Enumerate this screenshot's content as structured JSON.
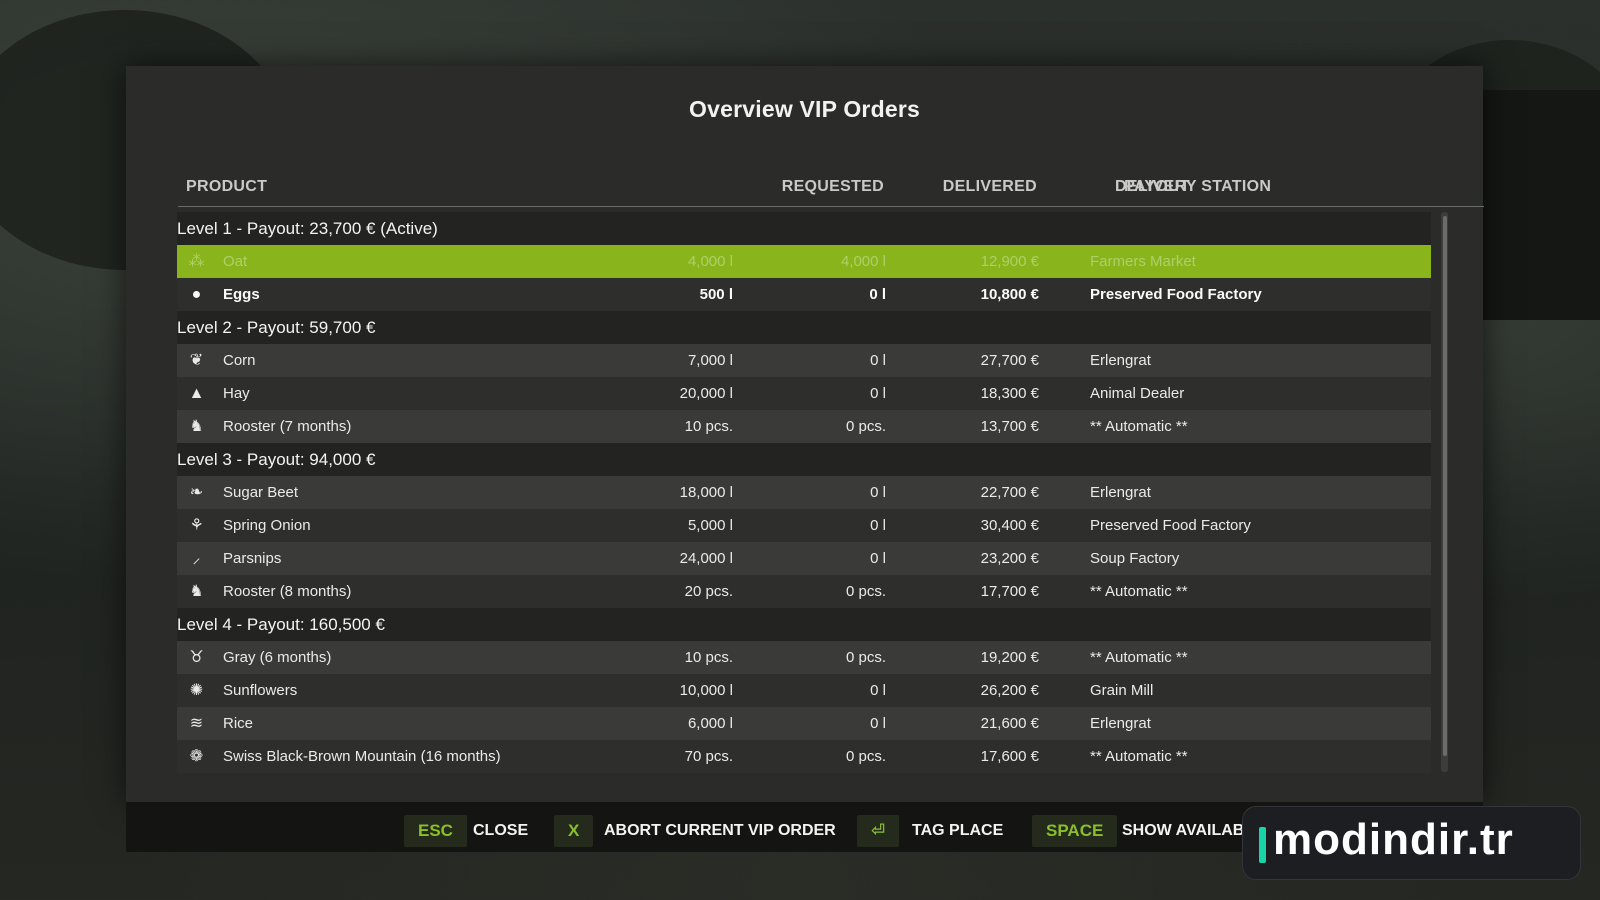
{
  "dialog": {
    "title": "Overview VIP Orders",
    "columns": {
      "product": "PRODUCT",
      "requested": "REQUESTED",
      "delivered": "DELIVERED",
      "payout": "PAYOUT",
      "station": "DELIVERY STATION"
    }
  },
  "groups": [
    {
      "label": "Level 1 - Payout: 23,700 € (Active)",
      "rows": [
        {
          "icon": "oat-icon",
          "glyph": "⁂",
          "name": "Oat",
          "requested": "4,000 l",
          "delivered": "4,000 l",
          "payout": "12,900 €",
          "station": "Farmers Market",
          "state": "completed"
        },
        {
          "icon": "eggs-icon",
          "glyph": "●",
          "name": "Eggs",
          "requested": "500 l",
          "delivered": "0 l",
          "payout": "10,800 €",
          "station": "Preserved Food Factory",
          "state": "open"
        }
      ]
    },
    {
      "label": "Level 2 - Payout: 59,700 €",
      "rows": [
        {
          "icon": "corn-icon",
          "glyph": "❦",
          "name": "Corn",
          "requested": "7,000 l",
          "delivered": "0 l",
          "payout": "27,700 €",
          "station": "Erlengrat"
        },
        {
          "icon": "hay-icon",
          "glyph": "▲",
          "name": "Hay",
          "requested": "20,000 l",
          "delivered": "0 l",
          "payout": "18,300 €",
          "station": "Animal Dealer"
        },
        {
          "icon": "rooster-icon",
          "glyph": "♞",
          "name": "Rooster (7 months)",
          "requested": "10 pcs.",
          "delivered": "0 pcs.",
          "payout": "13,700 €",
          "station": "** Automatic **"
        }
      ]
    },
    {
      "label": "Level 3 - Payout: 94,000 €",
      "rows": [
        {
          "icon": "sugar-beet-icon",
          "glyph": "❧",
          "name": "Sugar Beet",
          "requested": "18,000 l",
          "delivered": "0 l",
          "payout": "22,700 €",
          "station": "Erlengrat"
        },
        {
          "icon": "spring-onion-icon",
          "glyph": "⚘",
          "name": "Spring Onion",
          "requested": "5,000 l",
          "delivered": "0 l",
          "payout": "30,400 €",
          "station": "Preserved Food Factory"
        },
        {
          "icon": "parsnips-icon",
          "glyph": "⸝",
          "name": "Parsnips",
          "requested": "24,000 l",
          "delivered": "0 l",
          "payout": "23,200 €",
          "station": "Soup Factory"
        },
        {
          "icon": "rooster-icon",
          "glyph": "♞",
          "name": "Rooster (8 months)",
          "requested": "20 pcs.",
          "delivered": "0 pcs.",
          "payout": "17,700 €",
          "station": "** Automatic **"
        }
      ]
    },
    {
      "label": "Level 4 - Payout: 160,500 €",
      "rows": [
        {
          "icon": "goat-icon",
          "glyph": "♉",
          "name": "Gray (6 months)",
          "requested": "10 pcs.",
          "delivered": "0 pcs.",
          "payout": "19,200 €",
          "station": "** Automatic **"
        },
        {
          "icon": "sunflower-icon",
          "glyph": "✺",
          "name": "Sunflowers",
          "requested": "10,000 l",
          "delivered": "0 l",
          "payout": "26,200 €",
          "station": "Grain Mill"
        },
        {
          "icon": "rice-icon",
          "glyph": "≋",
          "name": "Rice",
          "requested": "6,000 l",
          "delivered": "0 l",
          "payout": "21,600 €",
          "station": "Erlengrat"
        },
        {
          "icon": "sheep-icon",
          "glyph": "❁",
          "name": "Swiss Black-Brown Mountain (16 months)",
          "requested": "70 pcs.",
          "delivered": "0 pcs.",
          "payout": "17,600 €",
          "station": "** Automatic **"
        }
      ]
    }
  ],
  "footer": {
    "esc_key": "ESC",
    "esc_label": "CLOSE",
    "x_key": "X",
    "x_label": "ABORT CURRENT VIP ORDER",
    "enter_key": "⏎",
    "enter_label": "TAG PLACE",
    "space_key": "SPACE",
    "space_label": "SHOW AVAILABLE DELIVERY PRODUCTS"
  },
  "watermark": {
    "text": "modindir.tr"
  },
  "colors": {
    "accent": "#8ab41c",
    "key_text": "#8bbf2a",
    "panel": "#2b2c2a"
  }
}
